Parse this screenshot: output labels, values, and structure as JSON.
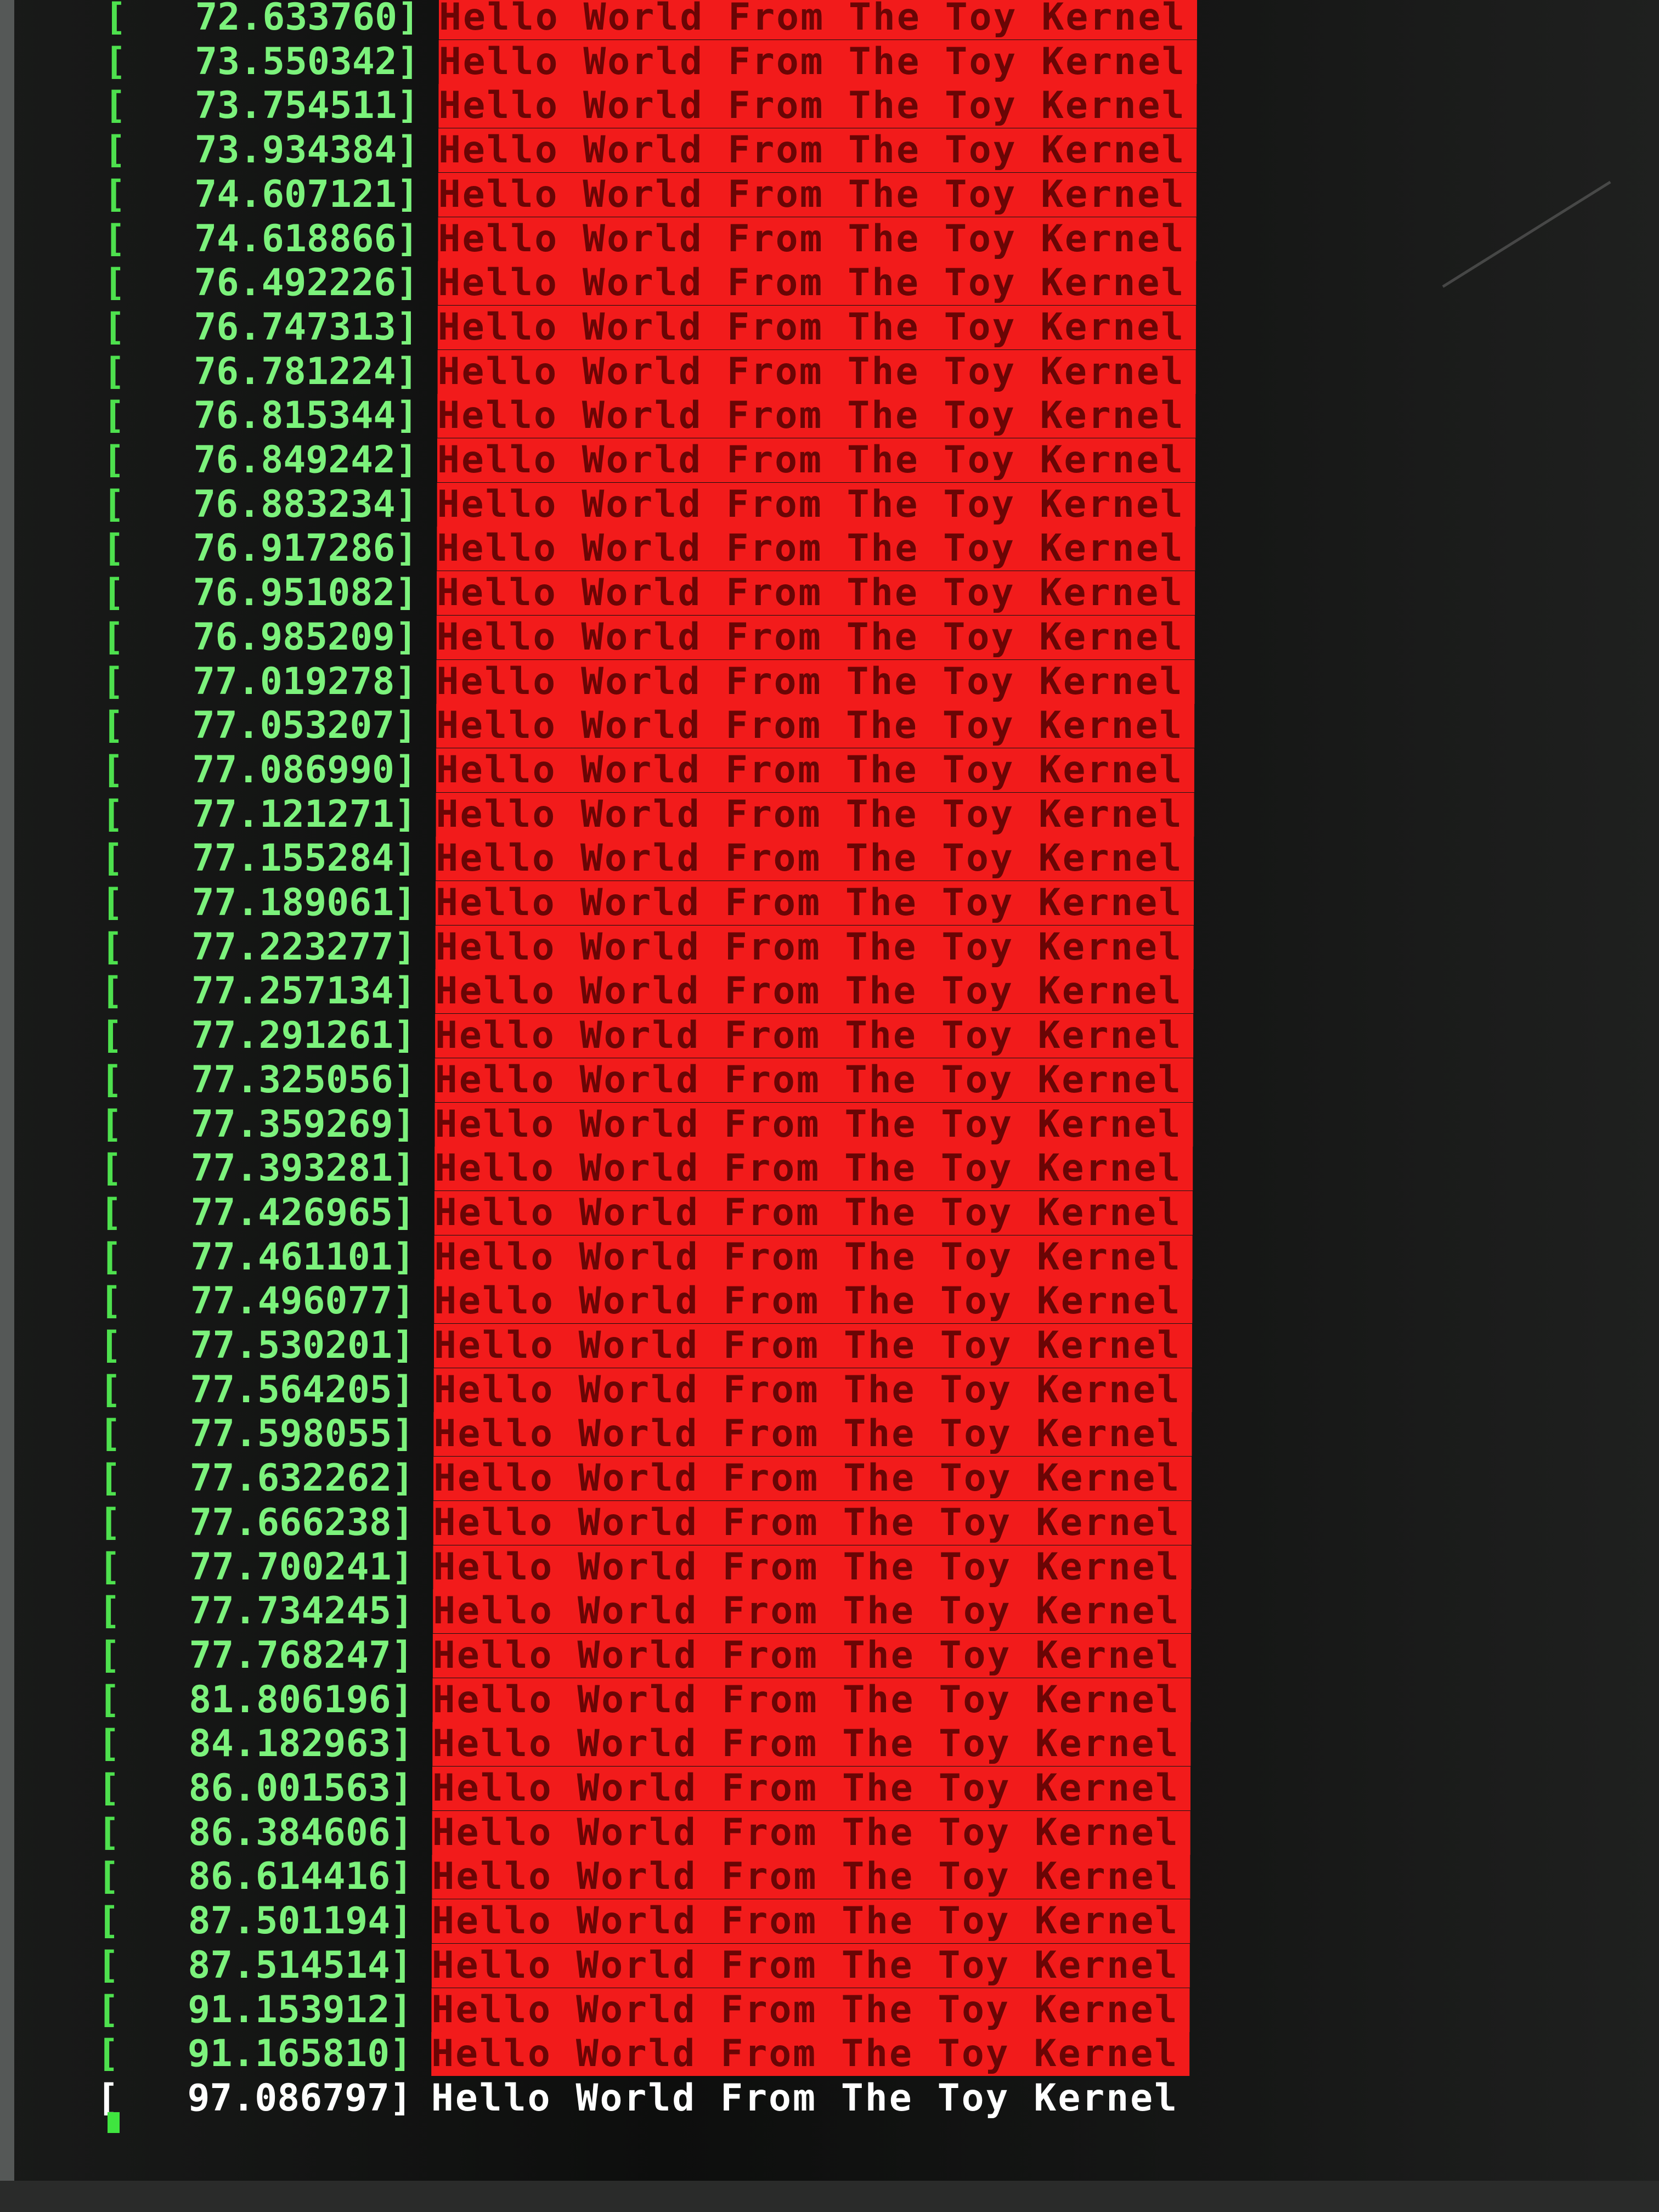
{
  "terminal": {
    "lines": [
      {
        "open": "[",
        "timestamp": "72.633760]",
        "message": "Hello World From The Toy Kernel"
      },
      {
        "open": "[",
        "timestamp": "73.550342]",
        "message": "Hello World From The Toy Kernel"
      },
      {
        "open": "[",
        "timestamp": "73.754511]",
        "message": "Hello World From The Toy Kernel"
      },
      {
        "open": "[",
        "timestamp": "73.934384]",
        "message": "Hello World From The Toy Kernel"
      },
      {
        "open": "[",
        "timestamp": "74.607121]",
        "message": "Hello World From The Toy Kernel"
      },
      {
        "open": "[",
        "timestamp": "74.618866]",
        "message": "Hello World From The Toy Kernel"
      },
      {
        "open": "[",
        "timestamp": "76.492226]",
        "message": "Hello World From The Toy Kernel"
      },
      {
        "open": "[",
        "timestamp": "76.747313]",
        "message": "Hello World From The Toy Kernel"
      },
      {
        "open": "[",
        "timestamp": "76.781224]",
        "message": "Hello World From The Toy Kernel"
      },
      {
        "open": "[",
        "timestamp": "76.815344]",
        "message": "Hello World From The Toy Kernel"
      },
      {
        "open": "[",
        "timestamp": "76.849242]",
        "message": "Hello World From The Toy Kernel"
      },
      {
        "open": "[",
        "timestamp": "76.883234]",
        "message": "Hello World From The Toy Kernel"
      },
      {
        "open": "[",
        "timestamp": "76.917286]",
        "message": "Hello World From The Toy Kernel"
      },
      {
        "open": "[",
        "timestamp": "76.951082]",
        "message": "Hello World From The Toy Kernel"
      },
      {
        "open": "[",
        "timestamp": "76.985209]",
        "message": "Hello World From The Toy Kernel"
      },
      {
        "open": "[",
        "timestamp": "77.019278]",
        "message": "Hello World From The Toy Kernel"
      },
      {
        "open": "[",
        "timestamp": "77.053207]",
        "message": "Hello World From The Toy Kernel"
      },
      {
        "open": "[",
        "timestamp": "77.086990]",
        "message": "Hello World From The Toy Kernel"
      },
      {
        "open": "[",
        "timestamp": "77.121271]",
        "message": "Hello World From The Toy Kernel"
      },
      {
        "open": "[",
        "timestamp": "77.155284]",
        "message": "Hello World From The Toy Kernel"
      },
      {
        "open": "[",
        "timestamp": "77.189061]",
        "message": "Hello World From The Toy Kernel"
      },
      {
        "open": "[",
        "timestamp": "77.223277]",
        "message": "Hello World From The Toy Kernel"
      },
      {
        "open": "[",
        "timestamp": "77.257134]",
        "message": "Hello World From The Toy Kernel"
      },
      {
        "open": "[",
        "timestamp": "77.291261]",
        "message": "Hello World From The Toy Kernel"
      },
      {
        "open": "[",
        "timestamp": "77.325056]",
        "message": "Hello World From The Toy Kernel"
      },
      {
        "open": "[",
        "timestamp": "77.359269]",
        "message": "Hello World From The Toy Kernel"
      },
      {
        "open": "[",
        "timestamp": "77.393281]",
        "message": "Hello World From The Toy Kernel"
      },
      {
        "open": "[",
        "timestamp": "77.426965]",
        "message": "Hello World From The Toy Kernel"
      },
      {
        "open": "[",
        "timestamp": "77.461101]",
        "message": "Hello World From The Toy Kernel"
      },
      {
        "open": "[",
        "timestamp": "77.496077]",
        "message": "Hello World From The Toy Kernel"
      },
      {
        "open": "[",
        "timestamp": "77.530201]",
        "message": "Hello World From The Toy Kernel"
      },
      {
        "open": "[",
        "timestamp": "77.564205]",
        "message": "Hello World From The Toy Kernel"
      },
      {
        "open": "[",
        "timestamp": "77.598055]",
        "message": "Hello World From The Toy Kernel"
      },
      {
        "open": "[",
        "timestamp": "77.632262]",
        "message": "Hello World From The Toy Kernel"
      },
      {
        "open": "[",
        "timestamp": "77.666238]",
        "message": "Hello World From The Toy Kernel"
      },
      {
        "open": "[",
        "timestamp": "77.700241]",
        "message": "Hello World From The Toy Kernel"
      },
      {
        "open": "[",
        "timestamp": "77.734245]",
        "message": "Hello World From The Toy Kernel"
      },
      {
        "open": "[",
        "timestamp": "77.768247]",
        "message": "Hello World From The Toy Kernel"
      },
      {
        "open": "[",
        "timestamp": "81.806196]",
        "message": "Hello World From The Toy Kernel"
      },
      {
        "open": "[",
        "timestamp": "84.182963]",
        "message": "Hello World From The Toy Kernel"
      },
      {
        "open": "[",
        "timestamp": "86.001563]",
        "message": "Hello World From The Toy Kernel"
      },
      {
        "open": "[",
        "timestamp": "86.384606]",
        "message": "Hello World From The Toy Kernel"
      },
      {
        "open": "[",
        "timestamp": "86.614416]",
        "message": "Hello World From The Toy Kernel"
      },
      {
        "open": "[",
        "timestamp": "87.501194]",
        "message": "Hello World From The Toy Kernel"
      },
      {
        "open": "[",
        "timestamp": "87.514514]",
        "message": "Hello World From The Toy Kernel"
      },
      {
        "open": "[",
        "timestamp": "91.153912]",
        "message": "Hello World From The Toy Kernel"
      },
      {
        "open": "[",
        "timestamp": "91.165810]",
        "message": "Hello World From The Toy Kernel"
      }
    ],
    "last_line": {
      "open": "[",
      "timestamp": "97.086797]",
      "message": "Hello World From The Toy Kernel"
    },
    "colors": {
      "screen_background": "#111211",
      "timestamp_green": "#7cf27c",
      "highlight_red": "#f21b1b",
      "highlight_text": "#6a0505",
      "last_line_text": "#ffffff",
      "cursor": "#3fe53f"
    }
  }
}
